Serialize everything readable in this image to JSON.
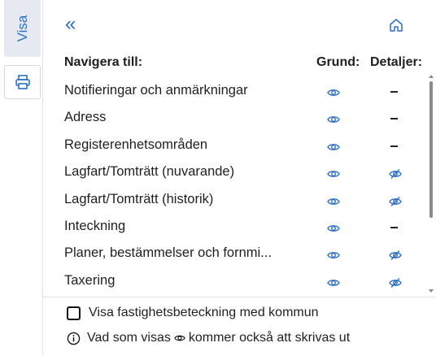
{
  "sidebar": {
    "visa_tab_label": "Visa"
  },
  "header": {
    "col_navigate": "Navigera till:",
    "col_grund": "Grund:",
    "col_detaljer": "Detaljer:"
  },
  "rows": [
    {
      "label": "Notifieringar och anmärkningar",
      "grund": "eye-icon",
      "detaljer": "dash"
    },
    {
      "label": "Adress",
      "grund": "eye-icon",
      "detaljer": "dash"
    },
    {
      "label": "Registerenhetsområden",
      "grund": "eye-icon",
      "detaljer": "dash"
    },
    {
      "label": "Lagfart/Tomträtt (nuvarande)",
      "grund": "eye-icon",
      "detaljer": "eye-slash-icon"
    },
    {
      "label": "Lagfart/Tomträtt (historik)",
      "grund": "eye-icon",
      "detaljer": "eye-slash-icon"
    },
    {
      "label": "Inteckning",
      "grund": "eye-icon",
      "detaljer": "dash"
    },
    {
      "label": "Planer, bestämmelser och fornmi...",
      "grund": "eye-icon",
      "detaljer": "eye-slash-icon"
    },
    {
      "label": "Taxering",
      "grund": "eye-icon",
      "detaljer": "eye-slash-icon"
    }
  ],
  "footer": {
    "checkbox_label": "Visa fastighetsbeteckning med kommun",
    "checkbox_checked": false,
    "info_text_before": "Vad som visas",
    "info_text_after": "kommer också att skrivas ut"
  },
  "colors": {
    "accent": "#2d6fc8",
    "tab_bg": "#e6e9f2"
  }
}
